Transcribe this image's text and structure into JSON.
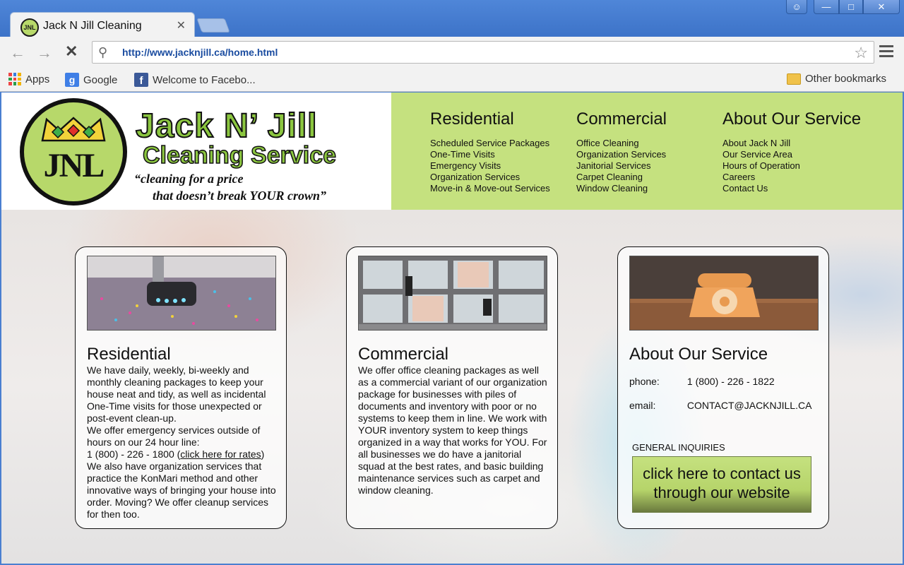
{
  "browser": {
    "tab_title": "Jack N Jill Cleaning",
    "tab_favicon_text": "JNL",
    "url": "http://www.jacknjill.ca/home.html",
    "bookmarks": {
      "apps": "Apps",
      "google": "Google",
      "facebook": "Welcome to Facebo...",
      "other": "Other bookmarks"
    }
  },
  "header": {
    "logo_text": "JNL",
    "brand_name": "Jack N’ Jill",
    "brand_sub": "Cleaning Service",
    "tagline_1": "“cleaning for a price",
    "tagline_2": "that doesn’t break YOUR crown”"
  },
  "nav": {
    "residential": {
      "title": "Residential",
      "items": [
        "Scheduled Service Packages",
        "One-Time Visits",
        "Emergency Visits",
        "Organization Services",
        "Move-in & Move-out Services"
      ]
    },
    "commercial": {
      "title": "Commercial",
      "items": [
        "Office Cleaning",
        "Organization Services",
        "Janitorial Services",
        "Carpet Cleaning",
        "Window Cleaning"
      ]
    },
    "about": {
      "title": "About Our Service",
      "items": [
        "About Jack N Jill",
        "Our Service Area",
        "Hours of Operation",
        "Careers",
        "Contact Us"
      ]
    }
  },
  "cards": {
    "residential": {
      "title": "Residential",
      "p1": "We have daily, weekly, bi-weekly and monthly cleaning packages to keep your house neat and tidy, as well as incidental One-Time visits for those unexpected or post-event clean-up.",
      "p2": "We offer emergency services outside of hours on our 24 hour line:",
      "phone": "1 (800) - 226 - 1800 (",
      "rates_link": "click here for rates",
      "phone_close": ")",
      "p3": "We also have organization services that practice the KonMari method and other innovative ways of bringing your house into order. Moving? We offer cleanup services for then too."
    },
    "commercial": {
      "title": "Commercial",
      "body": "We offer office cleaning packages as well as a commercial variant of our organization package for businesses with piles of documents and inventory with poor or no systems to keep them in line. We work with YOUR inventory system to keep things organized in a way that works for YOU. For all businesses we do have a janitorial squad at the best rates, and basic building maintenance services such as carpet and window cleaning."
    },
    "about": {
      "title": "About Our Service",
      "phone_label": "phone:",
      "phone_value": "1 (800) - 226 - 1822",
      "email_label": "email:",
      "email_value": "CONTACT@JACKNJILL.CA",
      "general_inquiries": "GENERAL INQUIRIES",
      "contact_button": "click here to contact us through our website"
    }
  },
  "colors": {
    "nav_bg": "#c5e17f",
    "brand_green": "#8bc63f",
    "chrome_blue": "#4a7fd0"
  }
}
